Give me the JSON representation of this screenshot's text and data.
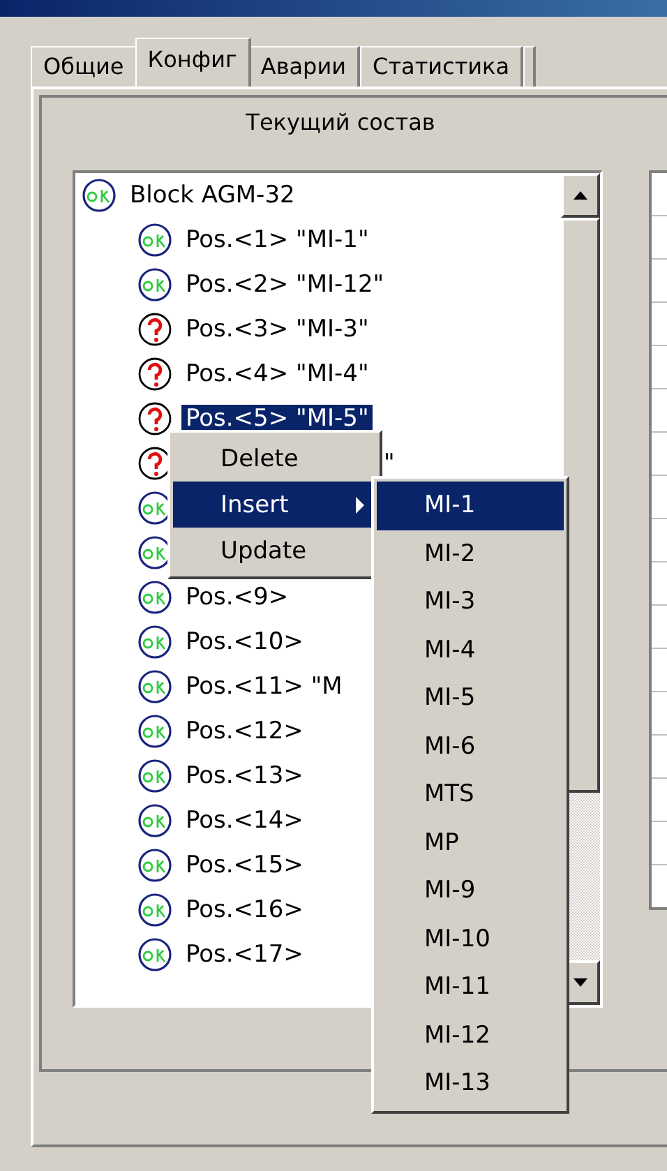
{
  "tabs": [
    {
      "label": "Общие",
      "selected": false
    },
    {
      "label": "Конфиг",
      "selected": true
    },
    {
      "label": "Аварии",
      "selected": false
    },
    {
      "label": "Статистика",
      "selected": false
    }
  ],
  "group": {
    "title": "Текущий состав"
  },
  "tree": {
    "label": "Block AGM-32",
    "kind": "ok",
    "children": [
      {
        "label": "Pos.<1> \"MI-1\"",
        "kind": "ok",
        "selected": false
      },
      {
        "label": "Pos.<2> \"MI-12\"",
        "kind": "ok",
        "selected": false
      },
      {
        "label": "Pos.<3> \"MI-3\"",
        "kind": "unknown",
        "selected": false
      },
      {
        "label": "Pos.<4> \"MI-4\"",
        "kind": "unknown",
        "selected": false
      },
      {
        "label": "Pos.<5> \"MI-5\"",
        "kind": "unknown",
        "selected": true
      },
      {
        "label": "\"",
        "kind": "unknown",
        "selected": false,
        "covered": true
      },
      {
        "kind": "ok"
      },
      {
        "kind": "ok"
      },
      {
        "label": "Pos.<9>",
        "kind": "ok",
        "selected": false
      },
      {
        "label": "Pos.<10>",
        "kind": "ok",
        "selected": false
      },
      {
        "label": "Pos.<11> \"M",
        "kind": "ok",
        "selected": false
      },
      {
        "label": "Pos.<12>",
        "kind": "ok",
        "selected": false
      },
      {
        "label": "Pos.<13>",
        "kind": "ok",
        "selected": false
      },
      {
        "label": "Pos.<14>",
        "kind": "ok",
        "selected": false
      },
      {
        "label": "Pos.<15>",
        "kind": "ok",
        "selected": false
      },
      {
        "label": "Pos.<16>",
        "kind": "ok",
        "selected": false
      },
      {
        "label": "Pos.<17>",
        "kind": "ok",
        "selected": false
      }
    ]
  },
  "context_menu": {
    "items": [
      {
        "label": "Delete",
        "selected": false,
        "submenu": false
      },
      {
        "label": "Insert",
        "selected": true,
        "submenu": true
      },
      {
        "label": "Update",
        "selected": false,
        "submenu": false
      }
    ]
  },
  "submenu": {
    "items": [
      {
        "label": "MI-1",
        "selected": true
      },
      {
        "label": "MI-2",
        "selected": false
      },
      {
        "label": "MI-3",
        "selected": false
      },
      {
        "label": "MI-4",
        "selected": false
      },
      {
        "label": "MI-5",
        "selected": false
      },
      {
        "label": "MI-6",
        "selected": false
      },
      {
        "label": "MTS",
        "selected": false
      },
      {
        "label": "MP",
        "selected": false
      },
      {
        "label": "MI-9",
        "selected": false
      },
      {
        "label": "MI-10",
        "selected": false
      },
      {
        "label": "MI-11",
        "selected": false
      },
      {
        "label": "MI-12",
        "selected": false
      },
      {
        "label": "MI-13",
        "selected": false
      }
    ]
  }
}
